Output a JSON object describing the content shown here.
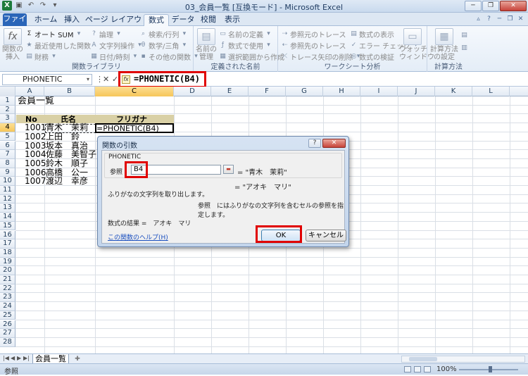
{
  "window": {
    "title": "03_会員一覧 [互換モード] - Microsoft Excel"
  },
  "colors": {
    "file_tab": "#2a65b8",
    "highlight": "#e00000",
    "header_fill": "#d9d0a5",
    "selection": "#f6c65a"
  },
  "tabs": [
    "ファイル",
    "ホーム",
    "挿入",
    "ページ レイアウト",
    "数式",
    "データ",
    "校閲",
    "表示"
  ],
  "ribbon": {
    "insert_function": "関数の\n挿入",
    "autosum": "オート SUM",
    "recent": "最近使用した関数",
    "financial": "財務",
    "logical": "論理",
    "text": "文字列操作",
    "datetime": "日付/時刻",
    "lookup": "検索/行列",
    "math": "数学/三角",
    "more": "その他の関数",
    "group_library": "関数ライブラリ",
    "name_manager": "名前の\n管理",
    "define_name": "名前の定義",
    "use_in_formula": "数式で使用",
    "create_from_selection": "選択範囲から作成",
    "group_names": "定義された名前",
    "trace_precedents": "参照元のトレース",
    "trace_dependents": "参照先のトレース",
    "remove_arrows": "トレース矢印の削除",
    "show_formulas": "数式の表示",
    "error_checking": "エラー チェック",
    "evaluate_formula": "数式の検証",
    "watch_window": "ウォッチ\nウィンドウ",
    "group_auditing": "ワークシート分析",
    "calc_options": "計算方法\nの設定",
    "group_calc": "計算方法"
  },
  "formula_bar": {
    "name_box": "PHONETIC",
    "fx": "fx",
    "formula": "=PHONETIC(B4)"
  },
  "columns": [
    "A",
    "B",
    "C",
    "D",
    "E",
    "F",
    "G",
    "H",
    "I",
    "J",
    "K",
    "L"
  ],
  "rows": [
    "1",
    "2",
    "3",
    "4",
    "5",
    "6",
    "7",
    "8",
    "9",
    "10",
    "11",
    "12",
    "13",
    "14",
    "15",
    "16",
    "17",
    "18",
    "19",
    "20",
    "21",
    "22",
    "23",
    "24",
    "25",
    "26",
    "27",
    "28"
  ],
  "sheet": {
    "title": "会員一覧",
    "headers": {
      "no": "No",
      "name": "氏名",
      "furigana": "フリガナ"
    },
    "c4": "=PHONETIC(B4)",
    "members": [
      {
        "no": "1001",
        "name": "青木　茉莉"
      },
      {
        "no": "1002",
        "name": "上田　鈴"
      },
      {
        "no": "1003",
        "name": "坂本　真治"
      },
      {
        "no": "1004",
        "name": "佐藤　美智子"
      },
      {
        "no": "1005",
        "name": "鈴木　順子"
      },
      {
        "no": "1006",
        "name": "高橋　公一"
      },
      {
        "no": "1007",
        "name": "渡辺　幸彦"
      }
    ],
    "tab_name": "会員一覧"
  },
  "dialog": {
    "title": "関数の引数",
    "help_button": "?",
    "close_button": "✕",
    "function_name": "PHONETIC",
    "arg_label": "参照",
    "arg_value": "B4",
    "arg_result": "= \"青木　茉莉\"",
    "function_value": "= \"アオキ　マリ\"",
    "function_description": "ふりがなの文字列を取り出します。",
    "arg_description": "参照　にはふりがなの文字列を含むセルの参照を指定します。",
    "formula_result": "数式の結果 =　アオキ　マリ",
    "help_link": "この関数のヘルプ(H)",
    "ok": "OK",
    "cancel": "キャンセル"
  },
  "status": {
    "mode": "参照",
    "zoom": "100%"
  }
}
